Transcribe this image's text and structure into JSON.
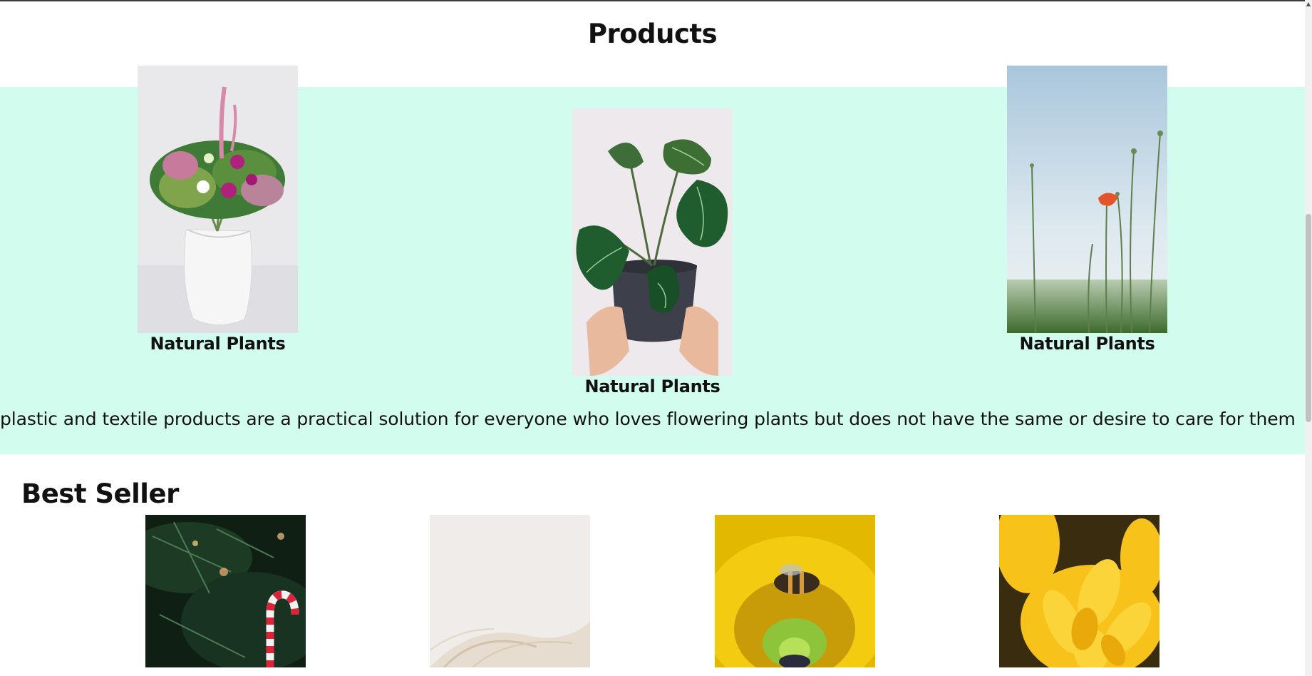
{
  "products": {
    "title": "Products",
    "items": [
      {
        "label": "Natural Plants",
        "image": "flower-bouquet-in-vase"
      },
      {
        "label": "Natural Plants",
        "image": "potted-plant-in-hands"
      },
      {
        "label": "Natural Plants",
        "image": "poppy-in-meadow"
      }
    ],
    "description": "plastic and textile products are a practical solution for everyone who loves flowering plants but does not have the same or desire to care for them"
  },
  "best_seller": {
    "title": "Best Seller",
    "items": [
      {
        "image": "christmas-tree-candy-cane"
      },
      {
        "image": "white-feathers"
      },
      {
        "image": "bee-on-sunflower"
      },
      {
        "image": "yellow-chrysanthemum"
      }
    ]
  },
  "colors": {
    "band_background": "#d2fdee",
    "page_background": "#ffffff"
  }
}
